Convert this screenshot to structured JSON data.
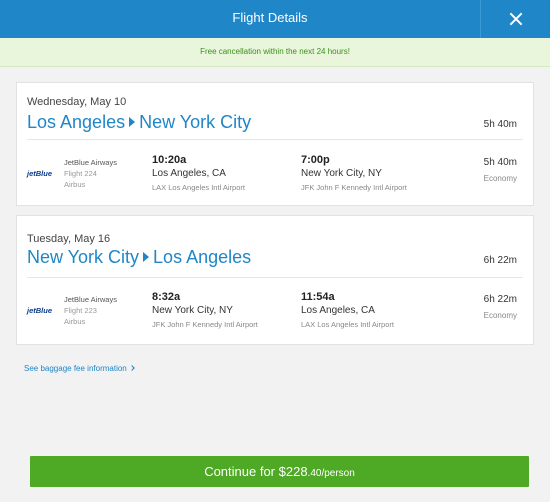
{
  "header": {
    "title": "Flight Details",
    "close_icon": "close-icon"
  },
  "notice": "Free cancellation within the next 24 hours!",
  "flights": [
    {
      "date": "Wednesday, May 10",
      "origin": "Los Angeles",
      "destination": "New York City",
      "duration": "5h 40m",
      "airline_logo": "jetBlue",
      "airline": "JetBlue Airways",
      "flight": "Flight 224",
      "aircraft": "Airbus",
      "depart_time": "10:20a",
      "depart_city": "Los Angeles, CA",
      "depart_airport": "LAX Los Angeles Intl Airport",
      "arrive_time": "7:00p",
      "arrive_city": "New York City, NY",
      "arrive_airport": "JFK John F Kennedy Intl Airport",
      "segment_duration": "5h 40m",
      "cabin": "Economy"
    },
    {
      "date": "Tuesday, May 16",
      "origin": "New York City",
      "destination": "Los Angeles",
      "duration": "6h 22m",
      "airline_logo": "jetBlue",
      "airline": "JetBlue Airways",
      "flight": "Flight 223",
      "aircraft": "Airbus",
      "depart_time": "8:32a",
      "depart_city": "New York City, NY",
      "depart_airport": "JFK John F Kennedy Intl Airport",
      "arrive_time": "11:54a",
      "arrive_city": "Los Angeles, CA",
      "arrive_airport": "LAX Los Angeles Intl Airport",
      "segment_duration": "6h 22m",
      "cabin": "Economy"
    }
  ],
  "baggage_link": "See baggage fee information",
  "continue": {
    "label": "Continue for ",
    "price": "$228",
    "cents": ".40/person"
  },
  "colors": {
    "brand_blue": "#1f86c8",
    "action_green": "#4ea924",
    "notice_green": "#3a8f1b"
  }
}
